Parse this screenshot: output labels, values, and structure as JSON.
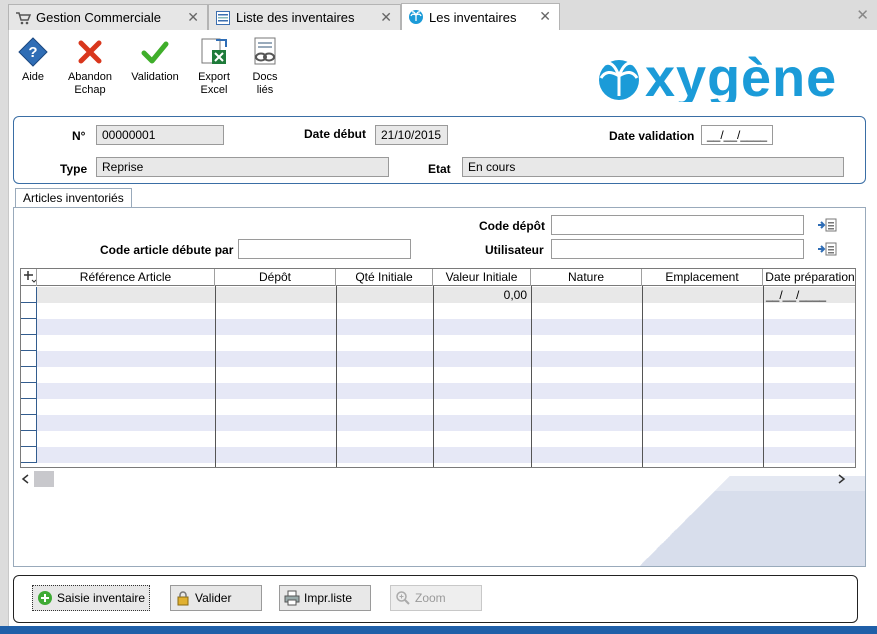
{
  "tabs": [
    {
      "label": "Gestion Commerciale"
    },
    {
      "label": "Liste des inventaires"
    },
    {
      "label": "Les inventaires"
    }
  ],
  "toolbar": {
    "aide": "Aide",
    "abandon_1": "Abandon",
    "abandon_2": "Echap",
    "validation": "Validation",
    "export_1": "Export",
    "export_2": "Excel",
    "docs_1": "Docs",
    "docs_2": "liés"
  },
  "logo": {
    "text": "oxygène",
    "color": "#1b9bd8"
  },
  "header": {
    "num_label": "N°",
    "num_value": "00000001",
    "date_debut_label": "Date début",
    "date_debut_value": "21/10/2015",
    "date_validation_label": "Date validation",
    "date_validation_value": "__/__/____",
    "type_label": "Type",
    "type_value": "Reprise",
    "etat_label": "Etat",
    "etat_value": "En cours"
  },
  "articles": {
    "tab_label": "Articles inventoriés",
    "code_depot_label": "Code dépôt",
    "code_depot_value": "",
    "code_article_label": "Code article débute par",
    "code_article_value": "",
    "utilisateur_label": "Utilisateur",
    "utilisateur_value": ""
  },
  "grid": {
    "columns": [
      "Référence Article",
      "Dépôt",
      "Qté Initiale",
      "Valeur Initiale",
      "Nature",
      "Emplacement",
      "Date préparation"
    ],
    "first_row": {
      "valeur_initiale": "0,00",
      "date_preparation": "__/__/____"
    }
  },
  "buttons": {
    "saisie": "Saisie inventaire",
    "valider": "Valider",
    "impr": "Impr.liste",
    "zoom": "Zoom"
  },
  "colors": {
    "accent": "#1f5fa8",
    "row_alt": "#e6e8f6",
    "border_blue": "#3a6ea5"
  }
}
